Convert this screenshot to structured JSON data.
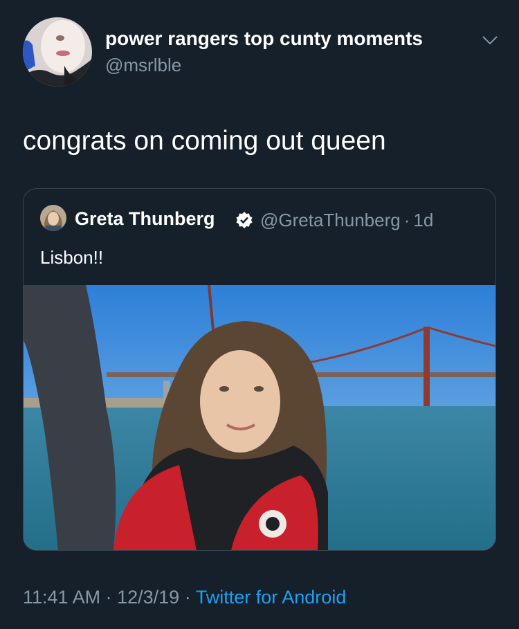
{
  "tweet": {
    "author_name": "power rangers top cunty moments",
    "author_handle": "@msrlble",
    "text": "congrats on coming out queen"
  },
  "quoted_tweet": {
    "author_name": "Greta Thunberg",
    "author_handle": "@GretaThunberg",
    "separator": "·",
    "age": "1d",
    "text": "Lisbon!!",
    "verified": true
  },
  "footer": {
    "time": "11:41 AM",
    "date": "12/3/19",
    "separator": "·",
    "source": "Twitter for Android"
  },
  "icons": {
    "menu": "chevron-down-icon",
    "verified": "verified-badge-icon"
  },
  "colors": {
    "background": "#15202b",
    "secondary_text": "#8899a6",
    "link": "#1da1f2",
    "border": "#38444d"
  }
}
